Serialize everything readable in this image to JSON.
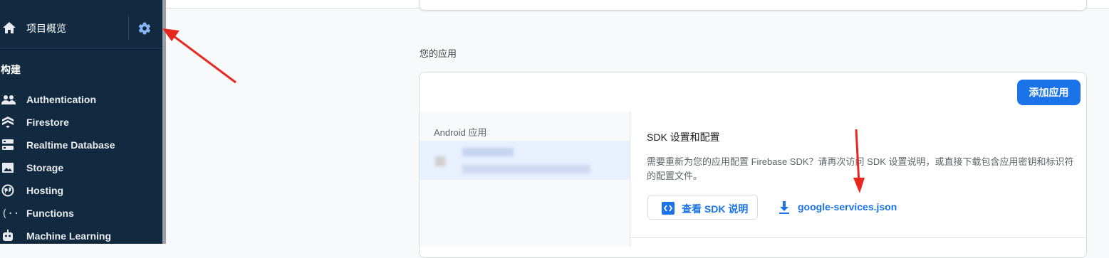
{
  "sidebar": {
    "overview_label": "项目概览",
    "section_title": "构建",
    "items": [
      {
        "label": "Authentication",
        "icon": "people-icon"
      },
      {
        "label": "Firestore",
        "icon": "firestore-icon"
      },
      {
        "label": "Realtime Database",
        "icon": "database-icon"
      },
      {
        "label": "Storage",
        "icon": "photo-icon"
      },
      {
        "label": "Hosting",
        "icon": "globe-icon"
      },
      {
        "label": "Functions",
        "icon": "functions-icon"
      },
      {
        "label": "Machine Learning",
        "icon": "robot-icon"
      }
    ]
  },
  "main": {
    "your_apps_label": "您的应用",
    "add_app_label": "添加应用",
    "android_label": "Android 应用",
    "sdk_title": "SDK 设置和配置",
    "sdk_description": "需要重新为您的应用配置 Firebase SDK？请再次访问 SDK 设置说明，或直接下载包含应用密钥和标识符的配置文件。",
    "view_sdk_label": "查看 SDK 说明",
    "download_label": "google-services.json"
  },
  "colors": {
    "sidebar_bg": "#122a40",
    "accent": "#1a73e8",
    "annotation_arrow": "#e8281e"
  }
}
